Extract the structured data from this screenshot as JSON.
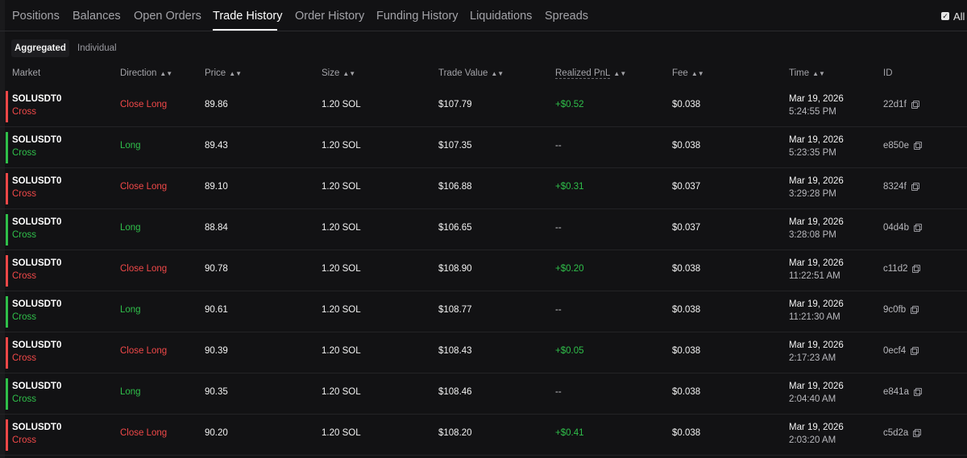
{
  "colors": {
    "red": "#f04848",
    "green": "#2fbf4a",
    "background": "#121214"
  },
  "tabs": [
    "Positions",
    "Balances",
    "Open Orders",
    "Trade History",
    "Order History",
    "Funding History",
    "Liquidations",
    "Spreads"
  ],
  "active_tab": "Trade History",
  "all_filter": {
    "label": "All",
    "checked": true
  },
  "subtabs": {
    "aggregated": "Aggregated",
    "individual": "Individual",
    "active": "Aggregated"
  },
  "columns": {
    "market": "Market",
    "direction": "Direction",
    "price": "Price",
    "size": "Size",
    "trade_value": "Trade Value",
    "realized_pnl": "Realized PnL",
    "fee": "Fee",
    "time": "Time",
    "id": "ID"
  },
  "rows": [
    {
      "market": "SOLUSDT0",
      "margin": "Cross",
      "direction": "Close Long",
      "price": "89.86",
      "size": "1.20 SOL",
      "value": "$107.79",
      "pnl": "+$0.52",
      "fee": "$0.038",
      "date": "Mar 19, 2026",
      "time": "5:24:55 PM",
      "id": "22d1f"
    },
    {
      "market": "SOLUSDT0",
      "margin": "Cross",
      "direction": "Long",
      "price": "89.43",
      "size": "1.20 SOL",
      "value": "$107.35",
      "pnl": "--",
      "fee": "$0.038",
      "date": "Mar 19, 2026",
      "time": "5:23:35 PM",
      "id": "e850e"
    },
    {
      "market": "SOLUSDT0",
      "margin": "Cross",
      "direction": "Close Long",
      "price": "89.10",
      "size": "1.20 SOL",
      "value": "$106.88",
      "pnl": "+$0.31",
      "fee": "$0.037",
      "date": "Mar 19, 2026",
      "time": "3:29:28 PM",
      "id": "8324f"
    },
    {
      "market": "SOLUSDT0",
      "margin": "Cross",
      "direction": "Long",
      "price": "88.84",
      "size": "1.20 SOL",
      "value": "$106.65",
      "pnl": "--",
      "fee": "$0.037",
      "date": "Mar 19, 2026",
      "time": "3:28:08 PM",
      "id": "04d4b"
    },
    {
      "market": "SOLUSDT0",
      "margin": "Cross",
      "direction": "Close Long",
      "price": "90.78",
      "size": "1.20 SOL",
      "value": "$108.90",
      "pnl": "+$0.20",
      "fee": "$0.038",
      "date": "Mar 19, 2026",
      "time": "11:22:51 AM",
      "id": "c11d2"
    },
    {
      "market": "SOLUSDT0",
      "margin": "Cross",
      "direction": "Long",
      "price": "90.61",
      "size": "1.20 SOL",
      "value": "$108.77",
      "pnl": "--",
      "fee": "$0.038",
      "date": "Mar 19, 2026",
      "time": "11:21:30 AM",
      "id": "9c0fb"
    },
    {
      "market": "SOLUSDT0",
      "margin": "Cross",
      "direction": "Close Long",
      "price": "90.39",
      "size": "1.20 SOL",
      "value": "$108.43",
      "pnl": "+$0.05",
      "fee": "$0.038",
      "date": "Mar 19, 2026",
      "time": "2:17:23 AM",
      "id": "0ecf4"
    },
    {
      "market": "SOLUSDT0",
      "margin": "Cross",
      "direction": "Long",
      "price": "90.35",
      "size": "1.20 SOL",
      "value": "$108.46",
      "pnl": "--",
      "fee": "$0.038",
      "date": "Mar 19, 2026",
      "time": "2:04:40 AM",
      "id": "e841a"
    },
    {
      "market": "SOLUSDT0",
      "margin": "Cross",
      "direction": "Close Long",
      "price": "90.20",
      "size": "1.20 SOL",
      "value": "$108.20",
      "pnl": "+$0.41",
      "fee": "$0.038",
      "date": "Mar 19, 2026",
      "time": "2:03:20 AM",
      "id": "c5d2a"
    }
  ]
}
